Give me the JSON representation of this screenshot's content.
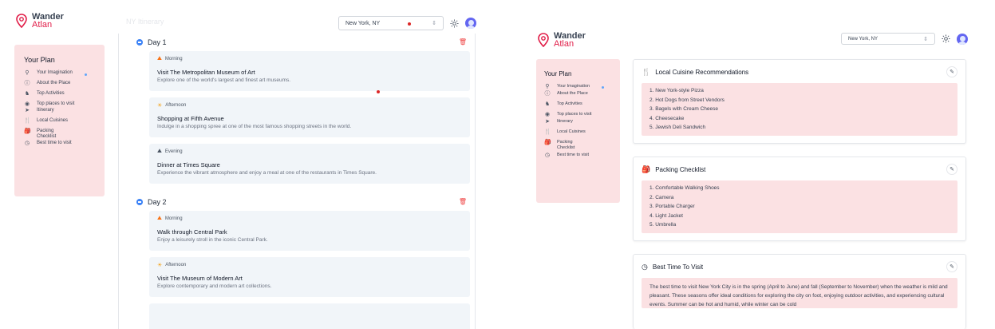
{
  "brand": {
    "line1": "Wander",
    "line2": "Atlan",
    "color": "#e11d48"
  },
  "location": {
    "city": "New York, NY"
  },
  "faded_title": "NY Itinerary",
  "sidebar": {
    "title": "Your Plan",
    "items": [
      {
        "label": "Your Imagination",
        "icon": "pin-icon"
      },
      {
        "label": "About the Place",
        "icon": "info-icon"
      },
      {
        "label": "Top Activities",
        "icon": "hiking-icon"
      },
      {
        "label": "Top places to visit",
        "icon": "location-icon"
      },
      {
        "label": "Itinerary",
        "icon": "send-icon"
      },
      {
        "label": "Local Cuisines",
        "icon": "cutlery-icon"
      },
      {
        "label": "Packing Checklist",
        "icon": "backpack-icon"
      },
      {
        "label": "Best time to visit",
        "icon": "clock-icon"
      }
    ]
  },
  "itinerary": {
    "days": [
      {
        "label": "Day 1",
        "activities": [
          {
            "time": "Morning",
            "title": "Visit The Metropolitan Museum of Art",
            "desc": "Explore one of the world's largest and finest art museums."
          },
          {
            "time": "Afternoon",
            "title": "Shopping at Fifth Avenue",
            "desc": "Indulge in a shopping spree at one of the most famous shopping streets in the world."
          },
          {
            "time": "Evening",
            "title": "Dinner at Times Square",
            "desc": "Experience the vibrant atmosphere and enjoy a meal at one of the restaurants in Times Square."
          }
        ]
      },
      {
        "label": "Day 2",
        "activities": [
          {
            "time": "Morning",
            "title": "Walk through Central Park",
            "desc": "Enjoy a leisurely stroll in the iconic Central Park."
          },
          {
            "time": "Afternoon",
            "title": "Visit The Museum of Modern Art",
            "desc": "Explore contemporary and modern art collections."
          }
        ]
      }
    ]
  },
  "cuisine": {
    "title": "Local Cuisine Recommendations",
    "items": [
      "1. New York-style Pizza",
      "2. Hot Dogs from Street Vendors",
      "3. Bagels with Cream Cheese",
      "4. Cheesecake",
      "5. Jewish Deli Sandwich"
    ]
  },
  "packing": {
    "title": "Packing Checklist",
    "items": [
      "1. Comfortable Walking Shoes",
      "2. Camera",
      "3. Portable Charger",
      "4. Light Jacket",
      "5. Umbrella"
    ]
  },
  "best_time": {
    "title": "Best Time To Visit",
    "text": "The best time to visit New York City is in the spring (April to June) and fall (September to November) when the weather is mild and pleasant. These seasons offer ideal conditions for exploring the city on foot, enjoying outdoor activities, and experiencing cultural events. Summer can be hot and humid, while winter can be cold"
  }
}
